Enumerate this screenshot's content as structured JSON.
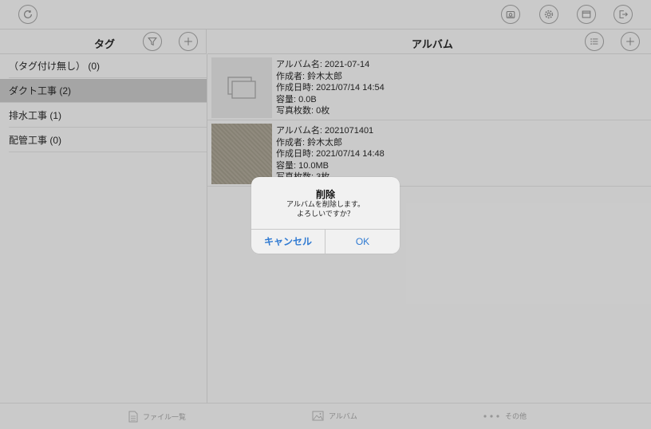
{
  "left": {
    "header_title": "タグ",
    "tags": [
      {
        "label": "（タグ付け無し） (0)",
        "selected": false
      },
      {
        "label": "ダクト工事 (2)",
        "selected": true
      },
      {
        "label": "排水工事 (1)",
        "selected": false
      },
      {
        "label": "配管工事 (0)",
        "selected": false
      }
    ]
  },
  "right": {
    "header_title": "アルバム",
    "albums": [
      {
        "name": "アルバム名:  2021-07-14",
        "author": "作成者:  鈴木太郎",
        "created": "作成日時:  2021/07/14 14:54",
        "size": "容量:  0.0B",
        "count": "写真枚数:  0枚"
      },
      {
        "name": "アルバム名:  2021071401",
        "author": "作成者:  鈴木太郎",
        "created": "作成日時:  2021/07/14 14:48",
        "size": "容量:  10.0MB",
        "count": "写真枚数:  3枚"
      }
    ]
  },
  "bottom_tabs": [
    {
      "label": "ファイル一覧",
      "icon": "document-icon"
    },
    {
      "label": "アルバム",
      "icon": "album-icon"
    },
    {
      "label": "その他",
      "icon": "more-dots-icon"
    }
  ],
  "dialog": {
    "title": "削除",
    "message_line1": "アルバムを削除します。",
    "message_line2": "よろしいですか？",
    "cancel_label": "キャンセル",
    "ok_label": "OK"
  },
  "colors": {
    "accent": "#2f7ad2",
    "selected_row": "#a9a9a9",
    "background": "#cfcfcf"
  }
}
